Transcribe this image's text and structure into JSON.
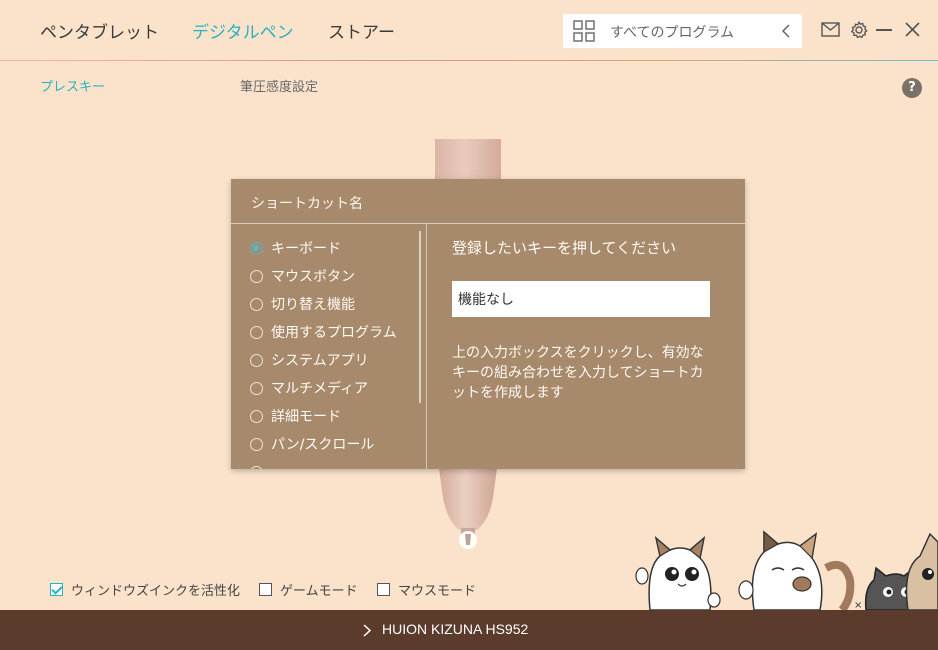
{
  "header": {
    "tabs": [
      {
        "label": "ペンタブレット"
      },
      {
        "label": "デジタルペン"
      },
      {
        "label": "ストアー"
      }
    ],
    "program_select": {
      "label": "すべてのプログラム",
      "icon": "grid-icon"
    },
    "icons": [
      "mail-icon",
      "gear-icon",
      "minimize-icon",
      "close-icon"
    ],
    "accent_color": "#29b1c1"
  },
  "subtabs": [
    {
      "label": "プレスキー"
    },
    {
      "label": "筆圧感度設定"
    }
  ],
  "help_label": "?",
  "dialog": {
    "title": "ショートカット名",
    "options": [
      {
        "label": "キーボード",
        "checked": true
      },
      {
        "label": "マウスボタン",
        "checked": false
      },
      {
        "label": "切り替え機能",
        "checked": false
      },
      {
        "label": "使用するプログラム",
        "checked": false
      },
      {
        "label": "システムアプリ",
        "checked": false
      },
      {
        "label": "マルチメディア",
        "checked": false
      },
      {
        "label": "詳細モード",
        "checked": false
      },
      {
        "label": "パン/スクロール",
        "checked": false
      }
    ],
    "prompt": "登録したいキーを押してください",
    "key_input_value": "機能なし",
    "help_text": "上の入力ボックスをクリックし、有効なキーの組み合わせを入力してショートカットを作成します",
    "background_color": "#a78a6c"
  },
  "bottom_options": [
    {
      "label": "ウィンドウズインクを活性化",
      "checked": true
    },
    {
      "label": "ゲームモード",
      "checked": false
    },
    {
      "label": "マウスモード",
      "checked": false
    }
  ],
  "footer": {
    "device_name": "HUION KIZUNA HS952",
    "background_color": "#5a3b2c"
  }
}
